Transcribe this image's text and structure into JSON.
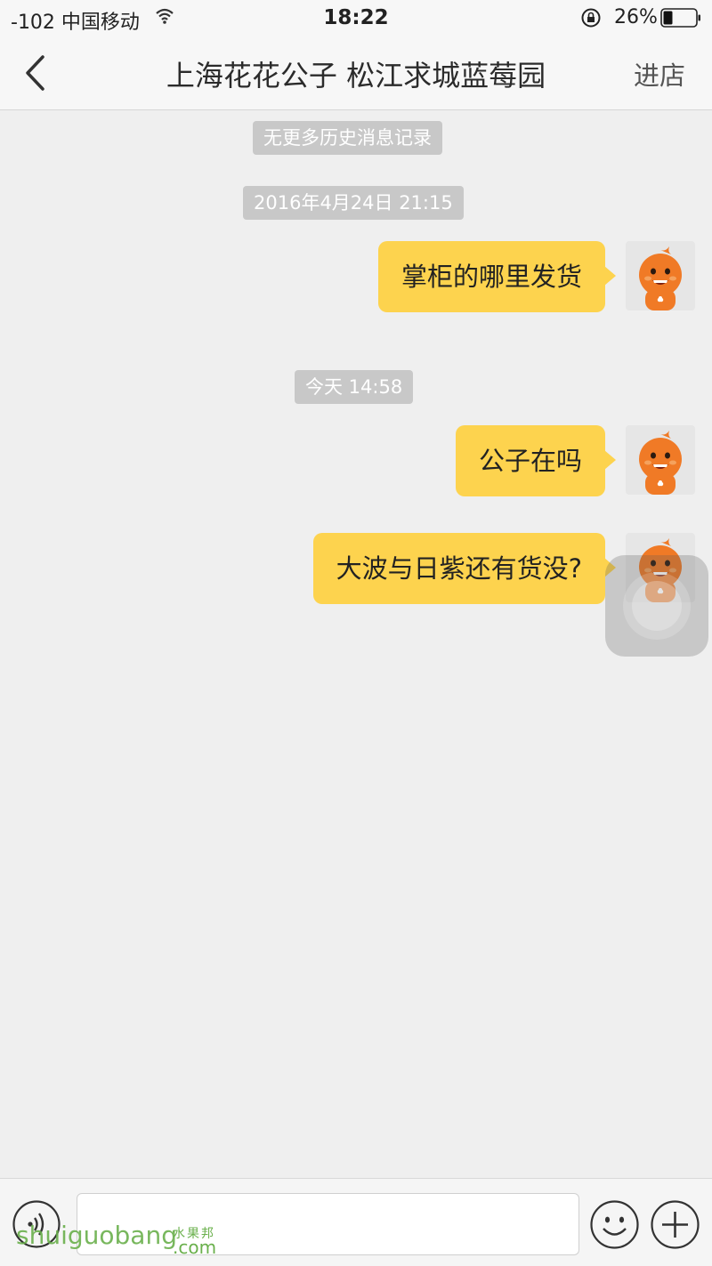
{
  "status_bar": {
    "signal": "-102 中国移动",
    "time": "18:22",
    "battery": "26%",
    "icons": [
      "wifi-icon",
      "orientation-lock-icon",
      "battery-icon"
    ]
  },
  "nav": {
    "back_icon": "chevron-left-icon",
    "title": "上海花花公子 松江求城蓝莓园",
    "action": "进店"
  },
  "chat": {
    "history_notice": "无更多历史消息记录",
    "timestamps": [
      "2016年4月24日 21:15",
      "今天 14:58"
    ],
    "messages": [
      {
        "text": "掌柜的哪里发货",
        "sender": "self"
      },
      {
        "text": "公子在吗",
        "sender": "self"
      },
      {
        "text": "大波与日紫还有货没?",
        "sender": "self"
      }
    ]
  },
  "input_bar": {
    "voice_icon": "voice-icon",
    "text_value": "",
    "emoji_icon": "emoji-icon",
    "plus_icon": "plus-icon"
  },
  "watermark": {
    "text": "shuiguobang",
    "cn": "水果邦",
    "suffix": ".com"
  },
  "colors": {
    "bubble": "#fdd34e",
    "background": "#efefef",
    "time_pill": "#c8c8c8",
    "avatar_orange": "#f07a26"
  }
}
